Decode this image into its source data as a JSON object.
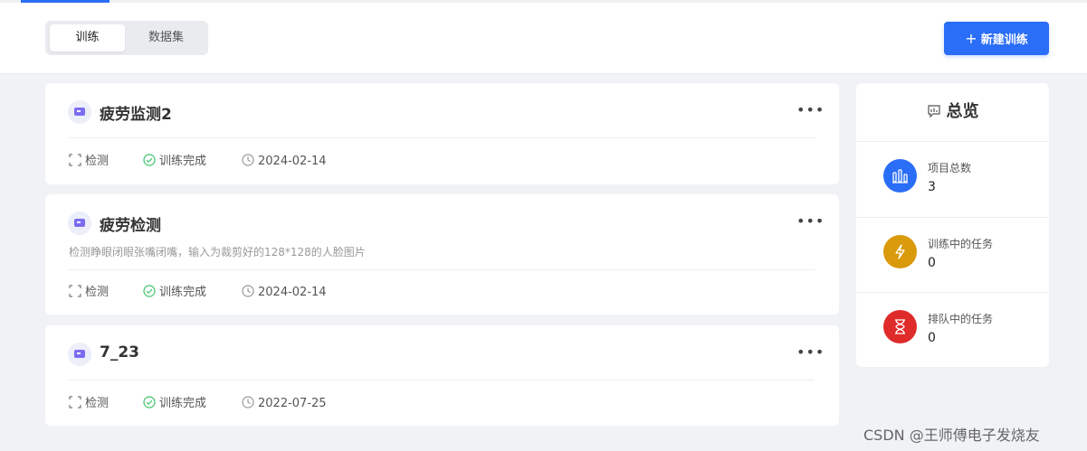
{
  "header": {
    "tabs": [
      "训练",
      "数据集"
    ],
    "new_button_label": "新建训练",
    "new_button_icon": "plus-icon",
    "accent_color": "#2a6df6"
  },
  "projects": [
    {
      "title": "疲劳监测2",
      "description": "",
      "type": "检测",
      "status": "训练完成",
      "date": "2024-02-14"
    },
    {
      "title": "疲劳检测",
      "description": "检测睁眼闭眼张嘴闭嘴，输入为裁剪好的128*128的人脸图片",
      "type": "检测",
      "status": "训练完成",
      "date": "2024-02-14"
    },
    {
      "title": "7_23",
      "description": "",
      "type": "检测",
      "status": "训练完成",
      "date": "2022-07-25"
    }
  ],
  "overview": {
    "title": "总览",
    "stats": [
      {
        "label": "项目总数",
        "value": "3",
        "color": "#2a6df6",
        "icon": "bar-chart-icon"
      },
      {
        "label": "训练中的任务",
        "value": "0",
        "color": "#d99a0b",
        "icon": "lightning-icon"
      },
      {
        "label": "排队中的任务",
        "value": "0",
        "color": "#e02b2b",
        "icon": "hourglass-icon"
      }
    ]
  },
  "watermark": "CSDN @王师傅电子发烧友"
}
